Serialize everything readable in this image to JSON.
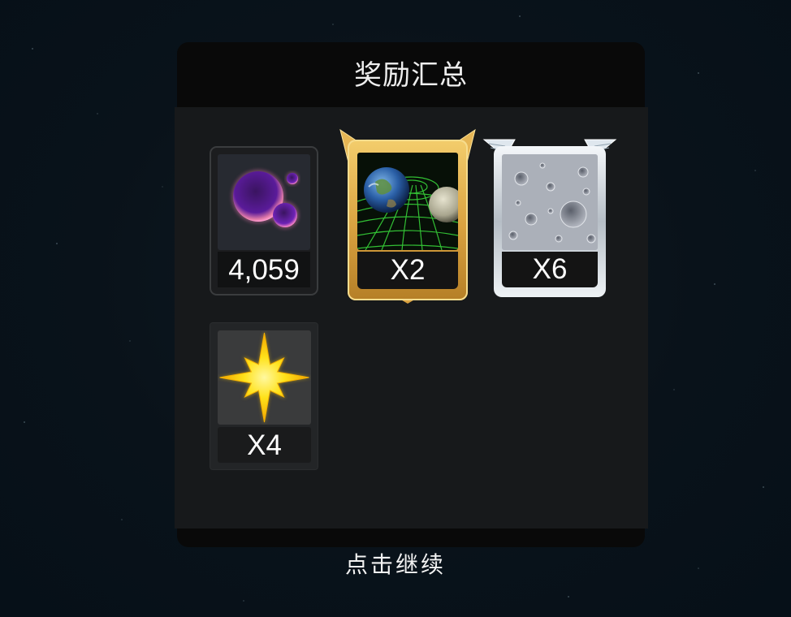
{
  "title": "奖励汇总",
  "rewards": [
    {
      "icon": "energy-orb-icon",
      "count": "4,059",
      "frame": "plain"
    },
    {
      "icon": "earth-gravity-grid-icon",
      "count": "X2",
      "frame": "gold"
    },
    {
      "icon": "moon-surface-icon",
      "count": "X6",
      "frame": "silver"
    },
    {
      "icon": "golden-star-icon",
      "count": "X4",
      "frame": "plain"
    }
  ],
  "continue_label": "点击继续",
  "colors": {
    "background": "#09121a",
    "panel": "#090909",
    "panel_body": "#17191b",
    "gold_frame": "#e3b04e",
    "silver_frame": "#c9d0d6",
    "text": "#ffffff"
  }
}
